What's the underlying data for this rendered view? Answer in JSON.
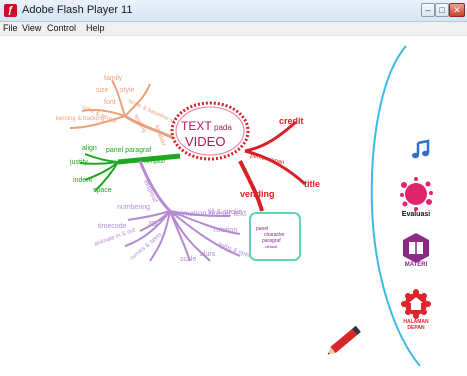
{
  "window": {
    "title": "Adobe Flash Player 11",
    "app_icon": "flash-icon"
  },
  "menu": [
    {
      "label": "File"
    },
    {
      "label": "View"
    },
    {
      "label": "Control"
    },
    {
      "label": "Help"
    }
  ],
  "mindmap": {
    "center": {
      "line1": "TEXT",
      "line1b": "pada",
      "line2": "VIDEO"
    },
    "red_branch": {
      "label": "pemersiapan",
      "items": [
        "credit",
        "title",
        "vending"
      ]
    },
    "orange_branch": {
      "label": "karakter",
      "items": [
        "family",
        "size",
        "style",
        "font",
        "scale & baseline shift",
        "kerning & tracking",
        "color & stroke",
        "leading"
      ]
    },
    "green_branch": {
      "label": "panel paragraf",
      "sub": "mengatur",
      "items": [
        "align",
        "justify",
        "indent",
        "space"
      ]
    },
    "purple_branch": {
      "label": "animation preset text",
      "items": [
        "ekspresif",
        "numbering",
        "3D",
        "timecode",
        "animate in & out",
        "curves & spins",
        "fill & stroke",
        "rotation",
        "lights & optics",
        "scale",
        "blurs"
      ]
    },
    "note_box": {
      "line1": "panel",
      "line2": "character",
      "line3": "paragraf",
      "line4": "...default"
    }
  },
  "sidebar": {
    "music_icon": "music-note-icon",
    "buttons": [
      {
        "label": "Evaluasi",
        "icon": "splash-icon",
        "color": "#e0246b"
      },
      {
        "label": "MATERI",
        "icon": "book-icon",
        "color": "#8a2b86"
      },
      {
        "label": "HALAMAN DEPAN",
        "icon": "home-icon",
        "color": "#e0222a"
      }
    ]
  },
  "colors": {
    "red": "#d92027",
    "orange": "#e8a27c",
    "green": "#1ca81f",
    "purple": "#b48ad2",
    "teal": "#5fd3b3",
    "cyan_curve": "#3cb9ea"
  }
}
